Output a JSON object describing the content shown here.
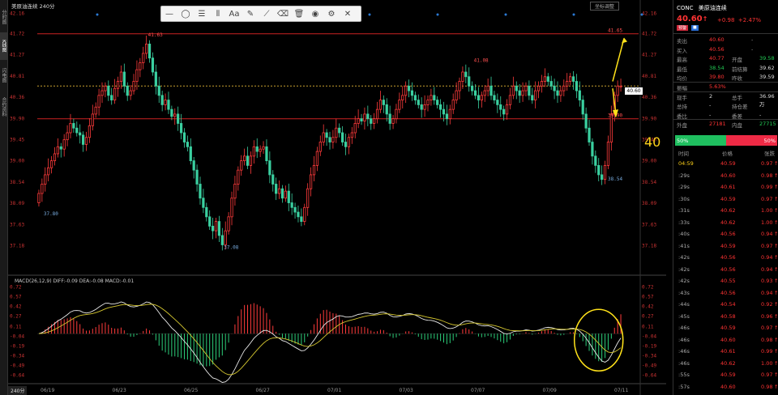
{
  "left_tabs": [
    "分时图",
    "K线图",
    "闪电图",
    "合约资料"
  ],
  "chart_title": "美原油连续 240分",
  "adjust_button": "坐标调整",
  "period_button": "240分",
  "toolbar": {
    "items": [
      {
        "name": "line-tool-icon",
        "glyph": "—"
      },
      {
        "name": "circle-tool-icon",
        "glyph": "◯"
      },
      {
        "name": "grid-tool-icon",
        "glyph": "☰"
      },
      {
        "name": "fib-tool-icon",
        "glyph": "⦀"
      },
      {
        "name": "text-tool-icon",
        "glyph": "Aa"
      },
      {
        "name": "pen-tool-icon",
        "glyph": "✎"
      },
      {
        "name": "ruler-tool-icon",
        "glyph": "⟋"
      },
      {
        "name": "eraser-tool-icon",
        "glyph": "⌫"
      },
      {
        "name": "trash-icon",
        "glyph": "🗑"
      },
      {
        "name": "eye-icon",
        "glyph": "◉"
      },
      {
        "name": "gear-icon",
        "glyph": "⚙"
      },
      {
        "name": "close-icon",
        "glyph": "✕"
      }
    ]
  },
  "big_annotation": "40",
  "current_price_tag": "40.60",
  "macd_label": "MACD(26,12,9) DIFF:-0.09 DEA:-0.08 MACD:-0.01",
  "chart_data": {
    "type": "candlestick",
    "price_axis": [
      "42.16",
      "41.72",
      "41.27",
      "40.81",
      "40.36",
      "39.90",
      "39.45",
      "39.00",
      "38.54",
      "38.09",
      "37.63",
      "37.18"
    ],
    "price_range": [
      37.0,
      42.2
    ],
    "macd_axis": [
      "0.72",
      "0.57",
      "0.42",
      "0.27",
      "0.11",
      "-0.04",
      "-0.19",
      "-0.34",
      "-0.49",
      "-0.64"
    ],
    "macd_range": [
      -0.72,
      0.8
    ],
    "x_labels": [
      "06/19",
      "06/23",
      "06/25",
      "06/27",
      "07/01",
      "07/03",
      "07/07",
      "07/09",
      "07/11"
    ],
    "resistance_line": 41.72,
    "support_line": 39.9,
    "current_line": 40.6,
    "annotations": [
      {
        "label": "41.63",
        "value": 41.63,
        "index": 34
      },
      {
        "label": "37.08",
        "value": 37.08,
        "index": 58
      },
      {
        "label": "41.08",
        "value": 41.08,
        "index": 137
      },
      {
        "label": "38.54",
        "value": 38.54,
        "index": 181
      },
      {
        "label": "37.80",
        "value": 37.8,
        "index": 1
      },
      {
        "label": "41.65",
        "value": 41.72,
        "index": 186
      },
      {
        "label": "39.90",
        "value": 39.9,
        "index": 186
      }
    ],
    "closes": [
      38.3,
      38.5,
      38.7,
      38.85,
      39.0,
      39.15,
      39.3,
      39.25,
      39.45,
      39.6,
      39.8,
      39.7,
      39.6,
      39.55,
      39.35,
      39.5,
      39.75,
      40.0,
      40.15,
      40.4,
      40.5,
      40.6,
      40.4,
      40.3,
      40.55,
      40.7,
      40.9,
      40.6,
      40.4,
      40.5,
      40.7,
      40.95,
      41.1,
      41.3,
      41.5,
      41.2,
      40.9,
      40.6,
      40.4,
      40.2,
      40.3,
      40.1,
      39.95,
      40.0,
      39.8,
      39.6,
      39.4,
      39.3,
      39.0,
      38.8,
      38.5,
      38.2,
      38.0,
      37.8,
      37.6,
      37.5,
      37.7,
      37.4,
      37.2,
      37.5,
      37.8,
      38.2,
      38.5,
      38.8,
      39.0,
      39.1,
      38.9,
      39.1,
      39.3,
      39.2,
      39.25,
      39.3,
      39.0,
      38.7,
      38.5,
      38.3,
      38.4,
      38.2,
      38.35,
      38.1,
      38.0,
      37.9,
      37.8,
      37.7,
      38.0,
      38.4,
      38.7,
      38.9,
      39.2,
      39.4,
      39.6,
      39.5,
      39.4,
      39.5,
      39.7,
      39.6,
      39.4,
      39.3,
      39.5,
      39.6,
      39.8,
      39.9,
      39.85,
      40.0,
      39.9,
      39.8,
      39.9,
      40.1,
      40.3,
      40.2,
      40.0,
      39.8,
      39.9,
      40.1,
      40.3,
      40.4,
      40.6,
      40.5,
      40.4,
      40.3,
      40.2,
      40.1,
      40.2,
      40.3,
      40.4,
      40.3,
      40.2,
      40.1,
      40.0,
      39.9,
      40.1,
      40.3,
      40.5,
      40.7,
      40.9,
      40.8,
      40.6,
      40.5,
      40.4,
      40.3,
      40.4,
      40.5,
      40.6,
      40.4,
      40.3,
      40.2,
      40.1,
      40.0,
      40.2,
      40.4,
      40.6,
      40.5,
      40.4,
      40.5,
      40.6,
      40.4,
      40.3,
      40.5,
      40.6,
      40.7,
      40.8,
      40.7,
      40.6,
      40.5,
      40.4,
      40.5,
      40.6,
      40.7,
      40.8,
      40.7,
      40.5,
      40.3,
      40.0,
      39.7,
      39.4,
      39.1,
      38.9,
      38.7,
      38.6,
      38.9,
      39.4,
      40.0,
      40.4,
      40.6,
      40.6
    ]
  },
  "quote": {
    "symbol": "CONC",
    "name": "美原油连续",
    "price": "40.60",
    "arrow": "↑",
    "change": "+0.98",
    "change_pct": "+2.47%",
    "badge1": "预警",
    "badge2": "■",
    "rows": [
      {
        "l": "卖出",
        "v": "40.60",
        "v2": "-",
        "v_color": "red"
      },
      {
        "l": "买入",
        "v": "40.56",
        "v2": "-",
        "v_color": "red"
      },
      {
        "l": "最高",
        "v": "40.77",
        "l2": "开盘",
        "v3": "39.58",
        "v_color": "red",
        "v3_color": "green"
      },
      {
        "l": "最低",
        "v": "38.54",
        "l2": "前结算",
        "v3": "39.62",
        "v_color": "green",
        "v3_color": "white"
      },
      {
        "l": "均价",
        "v": "39.80",
        "l2": "昨收",
        "v3": "39.59",
        "v_color": "red",
        "v3_color": "white"
      },
      {
        "l": "振幅",
        "v": "5.63%",
        "v_color": "red"
      },
      {
        "l": "现手",
        "v": "2",
        "l2": "总手",
        "v3": "36.96万",
        "v_color": "white",
        "v3_color": "white"
      },
      {
        "l": "总持",
        "v": "-",
        "l2": "持仓差",
        "v3": "-",
        "v_color": "white",
        "v3_color": "white"
      },
      {
        "l": "委比",
        "v": "-",
        "l2": "委差",
        "v3": "-",
        "v_color": "white",
        "v3_color": "white"
      },
      {
        "l": "外盘",
        "v": "27181",
        "l2": "内盘",
        "v3": "27715",
        "v_color": "red",
        "v3_color": "green"
      }
    ],
    "sentiment_left": "50%",
    "sentiment_right": "50%",
    "trade_headers": [
      "时间",
      "价格",
      "张跌"
    ],
    "trades": [
      {
        "t": "04:59",
        "p": "40.59",
        "c": "0.97"
      },
      {
        "t": ":29s",
        "p": "40.60",
        "c": "0.98"
      },
      {
        "t": ":29s",
        "p": "40.61",
        "c": "0.99"
      },
      {
        "t": ":30s",
        "p": "40.59",
        "c": "0.97"
      },
      {
        "t": ":31s",
        "p": "40.62",
        "c": "1.00"
      },
      {
        "t": ":33s",
        "p": "40.62",
        "c": "1.00"
      },
      {
        "t": ":40s",
        "p": "40.56",
        "c": "0.94"
      },
      {
        "t": ":41s",
        "p": "40.59",
        "c": "0.97"
      },
      {
        "t": ":42s",
        "p": "40.56",
        "c": "0.94"
      },
      {
        "t": ":42s",
        "p": "40.56",
        "c": "0.94"
      },
      {
        "t": ":42s",
        "p": "40.55",
        "c": "0.93"
      },
      {
        "t": ":43s",
        "p": "40.56",
        "c": "0.94"
      },
      {
        "t": ":44s",
        "p": "40.54",
        "c": "0.92"
      },
      {
        "t": ":45s",
        "p": "40.58",
        "c": "0.96"
      },
      {
        "t": ":46s",
        "p": "40.59",
        "c": "0.97"
      },
      {
        "t": ":46s",
        "p": "40.60",
        "c": "0.98"
      },
      {
        "t": ":46s",
        "p": "40.61",
        "c": "0.99"
      },
      {
        "t": ":46s",
        "p": "40.62",
        "c": "1.00"
      },
      {
        "t": ":55s",
        "p": "40.59",
        "c": "0.97"
      },
      {
        "t": ":57s",
        "p": "40.60",
        "c": "0.98"
      }
    ]
  }
}
